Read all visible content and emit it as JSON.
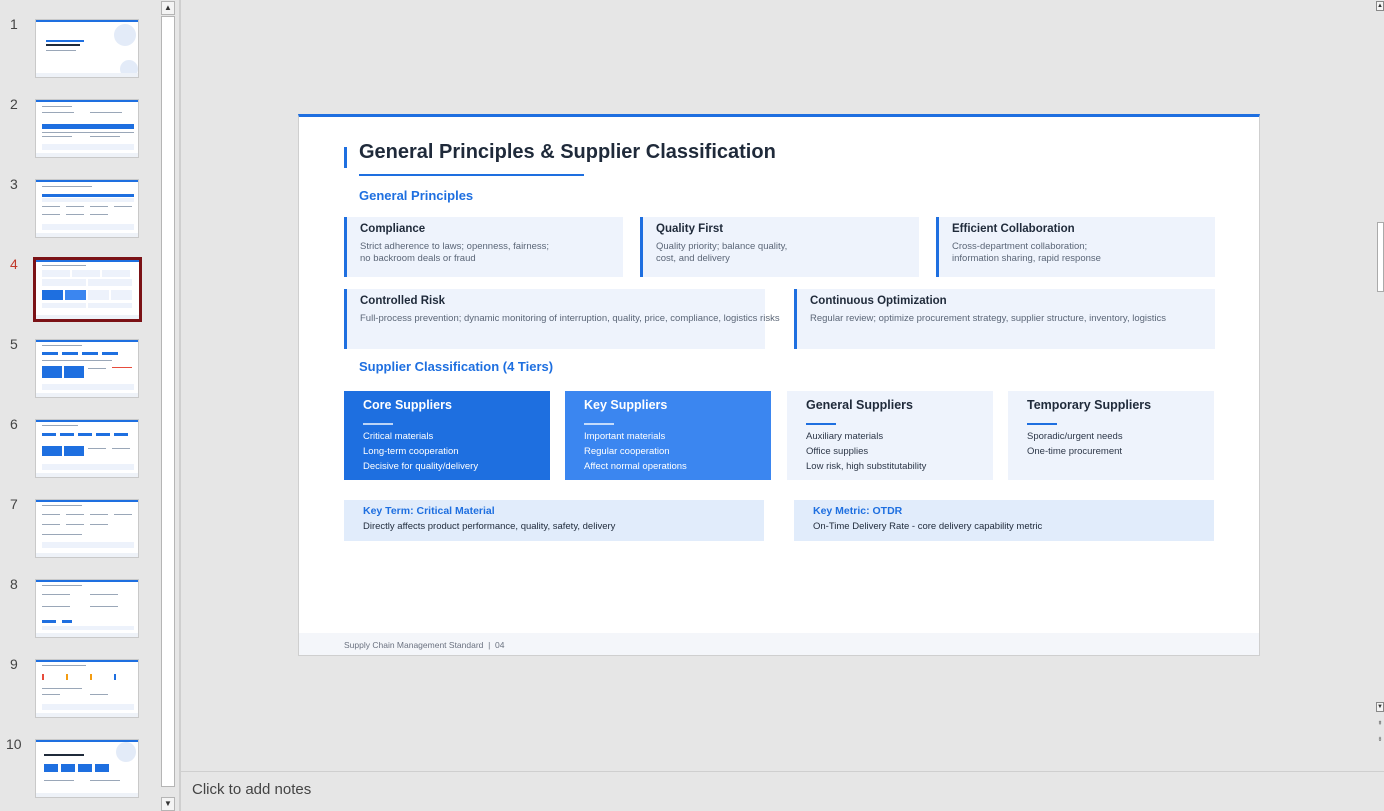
{
  "thumbnails": {
    "numbers": [
      "1",
      "2",
      "3",
      "4",
      "5",
      "6",
      "7",
      "8",
      "9",
      "10"
    ],
    "active_index": 4
  },
  "notes": {
    "placeholder": "Click to add notes"
  },
  "slide": {
    "title": "General Principles & Supplier Classification",
    "principles_heading": "General Principles",
    "principles": [
      {
        "title": "Compliance",
        "lines": [
          "Strict adherence to laws; openness, fairness;",
          "no backroom deals or fraud"
        ]
      },
      {
        "title": "Quality First",
        "lines": [
          "Quality priority; balance quality,",
          "cost, and delivery"
        ]
      },
      {
        "title": "Efficient Collaboration",
        "lines": [
          "Cross-department collaboration;",
          "information sharing, rapid response"
        ]
      },
      {
        "title": "Controlled Risk",
        "lines": [
          "Full-process prevention; dynamic monitoring of interruption, quality, price, compliance, logistics risks"
        ]
      },
      {
        "title": "Continuous Optimization",
        "lines": [
          "Regular review; optimize procurement strategy, supplier structure, inventory, logistics"
        ]
      }
    ],
    "classification_heading": "Supplier Classification (4 Tiers)",
    "tiers": [
      {
        "title": "Core Suppliers",
        "items": [
          "Critical materials",
          "Long-term cooperation",
          "Decisive for quality/delivery"
        ]
      },
      {
        "title": "Key Suppliers",
        "items": [
          "Important materials",
          "Regular cooperation",
          "Affect normal operations"
        ]
      },
      {
        "title": "General Suppliers",
        "items": [
          "Auxiliary materials",
          "Office supplies",
          "Low risk, high substitutability"
        ]
      },
      {
        "title": "Temporary Suppliers",
        "items": [
          "Sporadic/urgent needs",
          "One-time procurement"
        ]
      }
    ],
    "key_term": {
      "title": "Key Term: Critical Material",
      "desc": "Directly affects product performance, quality, safety, delivery"
    },
    "key_metric": {
      "title": "Key Metric: OTDR",
      "desc": "On-Time Delivery Rate - core delivery capability metric"
    },
    "footer": "Supply Chain Management Standard  |  04"
  },
  "colors": {
    "accent": "#1e6fe0",
    "accent_light": "#3b86f0",
    "card_bg": "#eef3fc",
    "active_thumb_border": "#7b1216"
  }
}
